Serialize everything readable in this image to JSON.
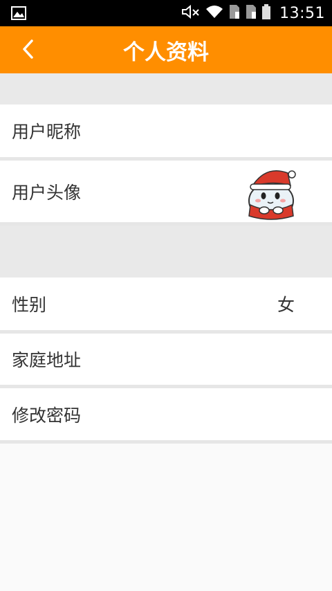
{
  "status_bar": {
    "time": "13:51",
    "icons": [
      "image-icon",
      "mute-icon",
      "wifi-icon",
      "sim1-icon",
      "sim2-icon",
      "battery-icon"
    ]
  },
  "header": {
    "title": "个人资料",
    "back_icon": "chevron-left-icon",
    "background": "#ff8e00"
  },
  "profile": {
    "nickname_label": "用户昵称",
    "avatar_label": "用户头像",
    "gender_label": "性别",
    "gender_value": "女",
    "address_label": "家庭地址",
    "password_label": "修改密码"
  }
}
